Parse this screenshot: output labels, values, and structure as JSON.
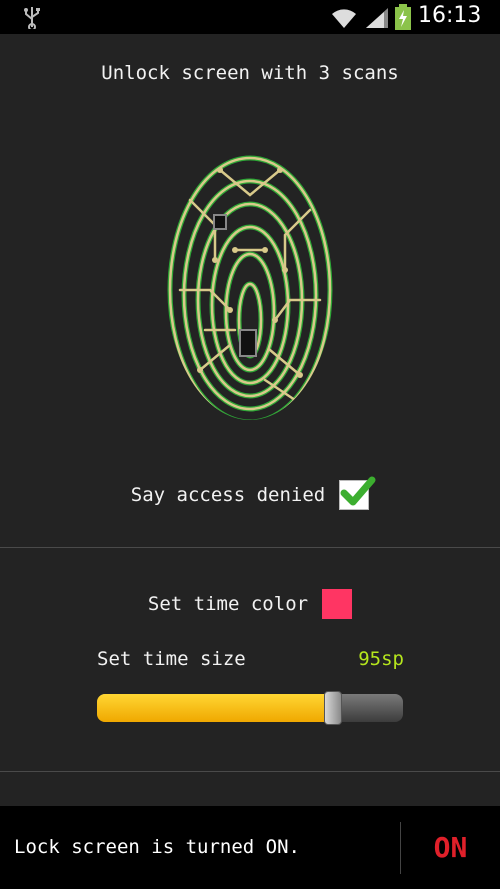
{
  "status_bar": {
    "time": "16:13",
    "icons": [
      "usb-icon",
      "wifi-icon",
      "signal-icon",
      "battery-charging-icon"
    ]
  },
  "header": {
    "title": "Unlock screen with 3 scans"
  },
  "fingerprint": {
    "icon": "fingerprint-circuit-icon",
    "colors": {
      "trace": "#d8c98a",
      "glow": "#2fbf3a"
    }
  },
  "access_denied": {
    "label": "Say access denied",
    "checked": true,
    "check_color": "#3cae2f"
  },
  "time_color": {
    "label": "Set time color",
    "swatch_color": "#ff3563"
  },
  "time_size": {
    "label": "Set time size",
    "value": "95sp",
    "slider_fraction": 0.77
  },
  "bottom_bar": {
    "status_text": "Lock screen is turned ON.",
    "toggle_label": "ON",
    "toggle_color": "#e0202a"
  }
}
